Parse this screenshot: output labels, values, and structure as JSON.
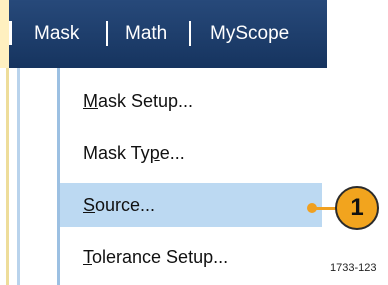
{
  "menubar": {
    "items": [
      "Mask",
      "Math",
      "MyScope"
    ]
  },
  "mask_menu": {
    "options": [
      {
        "prefix": "",
        "accel": "M",
        "rest": "ask Setup..."
      },
      {
        "prefix": "Mask Ty",
        "accel": "p",
        "rest": "e..."
      },
      {
        "prefix": "",
        "accel": "S",
        "rest": "ource..."
      },
      {
        "prefix": "",
        "accel": "T",
        "rest": "olerance Setup..."
      }
    ],
    "selected_index": 2
  },
  "callout": {
    "label": "1"
  },
  "figure_id": "1733-123",
  "colors": {
    "menubar": "#1d3f6e",
    "selection": "#bcd9f2",
    "callout": "#f2a41e"
  }
}
